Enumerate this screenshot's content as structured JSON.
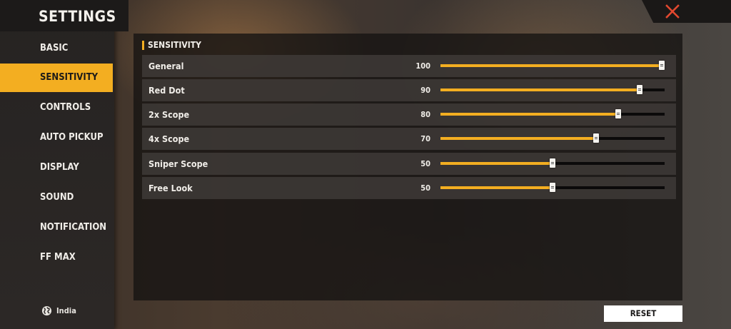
{
  "app": {
    "title": "SETTINGS"
  },
  "sidebar": {
    "items": [
      {
        "label": "BASIC",
        "active": false
      },
      {
        "label": "SENSITIVITY",
        "active": true
      },
      {
        "label": "CONTROLS",
        "active": false
      },
      {
        "label": "AUTO PICKUP",
        "active": false
      },
      {
        "label": "DISPLAY",
        "active": false
      },
      {
        "label": "SOUND",
        "active": false
      },
      {
        "label": "NOTIFICATION",
        "active": false
      },
      {
        "label": "FF MAX",
        "active": false
      }
    ],
    "region": {
      "label": "India",
      "icon": "globe-icon"
    }
  },
  "section": {
    "title": "SENSITIVITY"
  },
  "sliders": [
    {
      "label": "General",
      "value": "100",
      "level": 100,
      "max": 100
    },
    {
      "label": "Red Dot",
      "value": "90",
      "level": 90,
      "max": 100
    },
    {
      "label": "2x Scope",
      "value": "80",
      "level": 80,
      "max": 100
    },
    {
      "label": "4x Scope",
      "value": "70",
      "level": 70,
      "max": 100
    },
    {
      "label": "Sniper Scope",
      "value": "50",
      "level": 50,
      "max": 100
    },
    {
      "label": "Free Look",
      "value": "50",
      "level": 50,
      "max": 100
    }
  ],
  "footer": {
    "reset_label": "RESET"
  },
  "close": {
    "icon": "close-icon"
  },
  "colors": {
    "accent": "#f3ae21",
    "close": "#e2482f"
  }
}
